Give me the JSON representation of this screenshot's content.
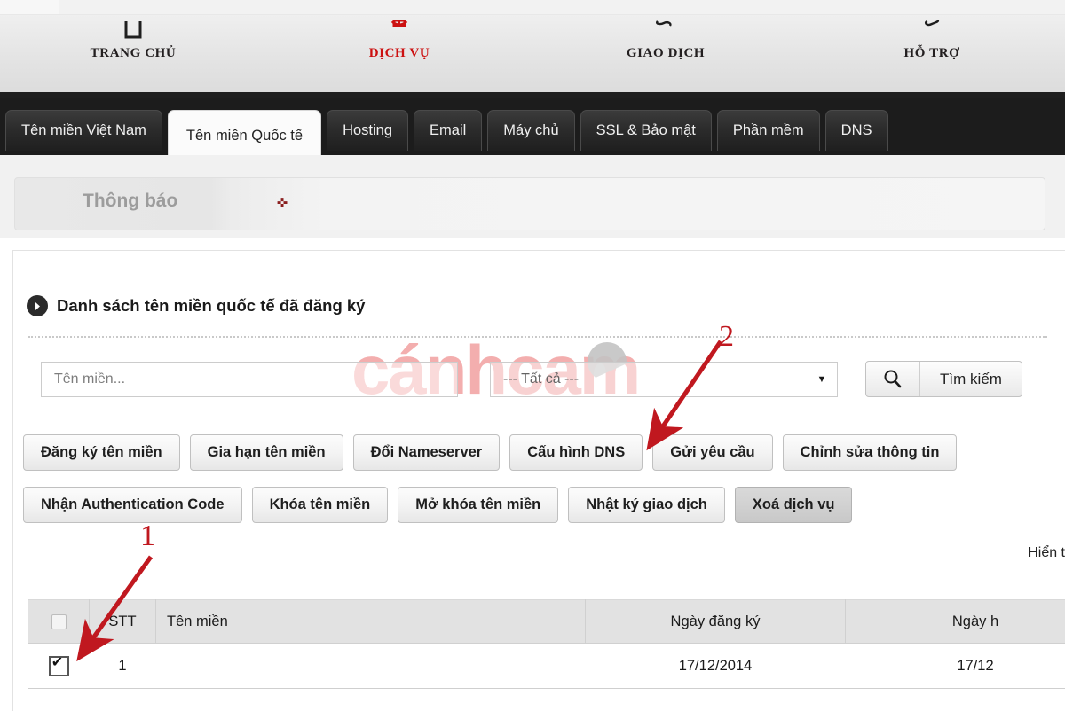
{
  "topnav": {
    "items": [
      {
        "label": "TRANG CHỦ",
        "icon": "home-icon",
        "active": false
      },
      {
        "label": "DỊCH VỤ",
        "icon": "services-icon",
        "active": true
      },
      {
        "label": "GIAO DỊCH",
        "icon": "transaction-icon",
        "active": false
      },
      {
        "label": "HỖ TRỢ",
        "icon": "support-icon",
        "active": false
      }
    ],
    "active_color": "#cc1111"
  },
  "tabs": [
    {
      "label": "Tên miền Việt Nam",
      "active": false
    },
    {
      "label": "Tên miền Quốc tế",
      "active": true
    },
    {
      "label": "Hosting",
      "active": false
    },
    {
      "label": "Email",
      "active": false
    },
    {
      "label": "Máy chủ",
      "active": false
    },
    {
      "label": "SSL & Bảo mật",
      "active": false
    },
    {
      "label": "Phần mềm",
      "active": false
    },
    {
      "label": "DNS",
      "active": false
    }
  ],
  "notice": {
    "label": "Thông báo",
    "marker": "✜"
  },
  "section": {
    "title": "Danh sách tên miền quốc tế đã đăng ký",
    "icon": "arrow-right-circle-icon"
  },
  "search": {
    "domain_placeholder": "Tên miền...",
    "domain_value": "",
    "filter_selected": "--- Tất cả ---",
    "filter_options": [
      "--- Tất cả ---"
    ],
    "search_button": "Tìm kiếm",
    "search_icon": "magnifier-icon",
    "caret_icon": "chevron-down-icon"
  },
  "actions": {
    "row1": [
      {
        "label": "Đăng ký tên miền",
        "pressed": false
      },
      {
        "label": "Gia hạn tên miền",
        "pressed": false
      },
      {
        "label": "Đổi Nameserver",
        "pressed": false
      },
      {
        "label": "Cấu hình DNS",
        "pressed": false
      },
      {
        "label": "Gửi yêu cầu",
        "pressed": false
      },
      {
        "label": "Chỉnh sửa thông tin",
        "pressed": false
      }
    ],
    "row2": [
      {
        "label": "Nhận Authentication Code",
        "pressed": false
      },
      {
        "label": "Khóa tên miền",
        "pressed": false
      },
      {
        "label": "Mở khóa tên miền",
        "pressed": false
      },
      {
        "label": "Nhật ký giao dịch",
        "pressed": false
      },
      {
        "label": "Xoá dịch vụ",
        "pressed": true
      }
    ]
  },
  "table": {
    "show_note": "Hiển t",
    "headers": {
      "select_all": "",
      "stt": "STT",
      "domain": "Tên miền",
      "register_date": "Ngày đăng ký",
      "expire_date": "Ngày h"
    },
    "rows": [
      {
        "checked": true,
        "stt": "1",
        "domain": "",
        "register_date": "17/12/2014",
        "expire_date": "17/12"
      }
    ]
  },
  "watermark": {
    "text_left": "cánh",
    "text_right": "cam",
    "color": "#f2a0a0"
  },
  "annotations": [
    {
      "number": "1",
      "color": "#c0181f",
      "target": "row-checkbox"
    },
    {
      "number": "2",
      "color": "#c0181f",
      "target": "cau-hinh-dns-button"
    }
  ]
}
